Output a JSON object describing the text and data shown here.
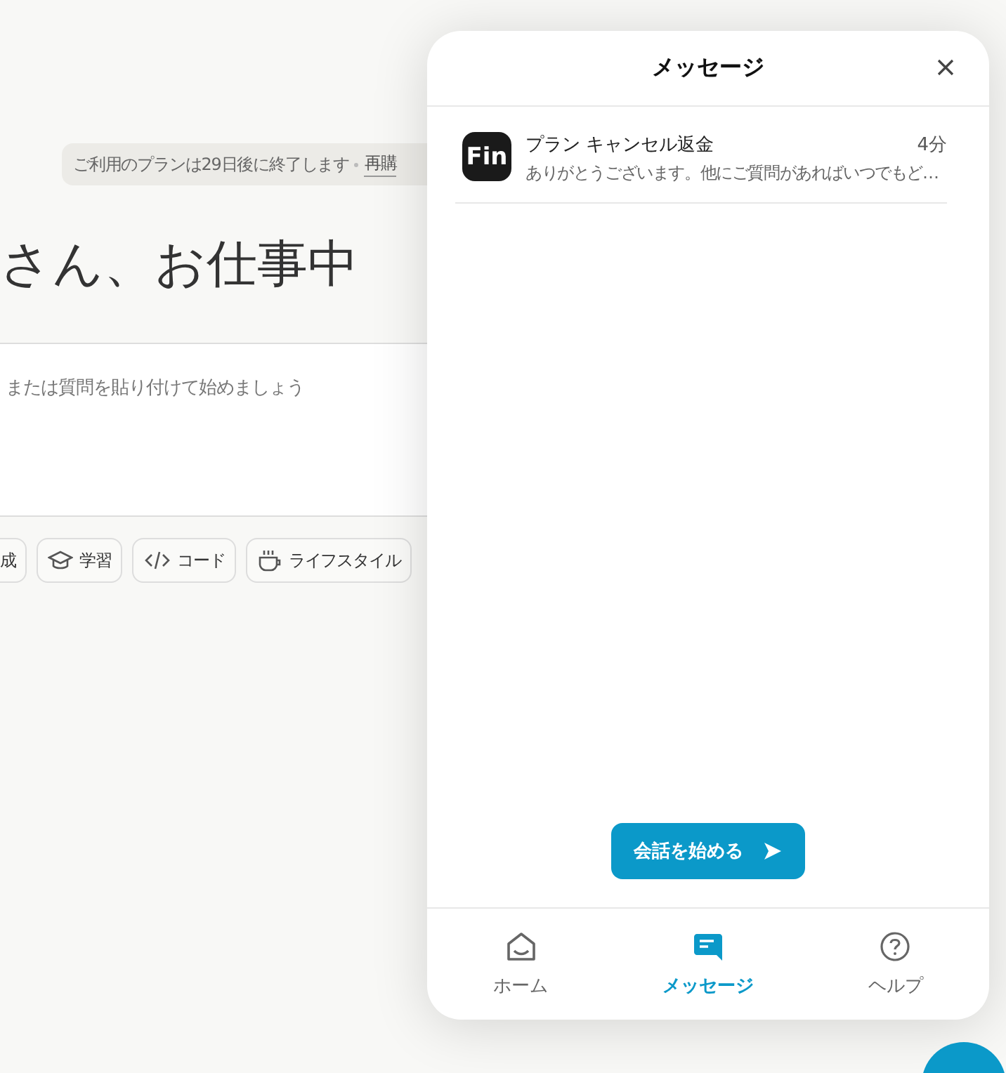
{
  "background_page": {
    "banner": {
      "text": "ご利用のプランは29日後に終了します",
      "link": "再購"
    },
    "greeting": "さん、お仕事中",
    "prompt_field": {
      "placeholder": "または質問を貼り付けて始めましょう"
    },
    "chips": [
      {
        "kind": "write",
        "label": "成"
      },
      {
        "kind": "learn",
        "label": "学習"
      },
      {
        "kind": "code",
        "label": "コード"
      },
      {
        "kind": "life",
        "label": "ライフスタイル"
      }
    ]
  },
  "messenger": {
    "title": "メッセージ",
    "conversations": [
      {
        "avatar": "Fin",
        "title": "プラン キャンセル返金",
        "time": "4分",
        "preview": "ありがとうございます。他にご質問があればいつでもど…"
      }
    ],
    "start_button": "会話を始める",
    "nav": [
      {
        "kind": "home",
        "label": "ホーム",
        "selected": false
      },
      {
        "kind": "messages",
        "label": "メッセージ",
        "selected": true
      },
      {
        "kind": "help",
        "label": "ヘルプ",
        "selected": false
      }
    ]
  }
}
